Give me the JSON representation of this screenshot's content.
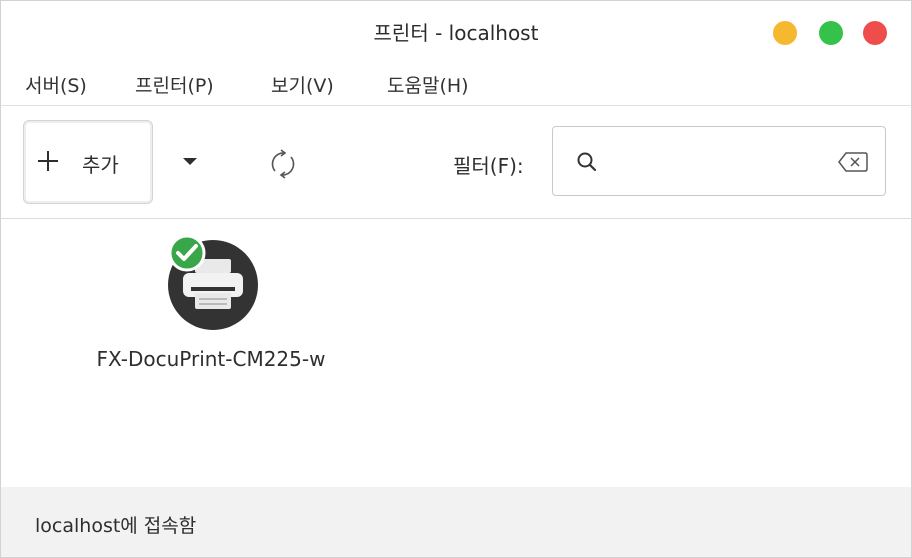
{
  "window": {
    "title": "프린터 - localhost"
  },
  "menubar": {
    "items": [
      {
        "label": "서버(S)"
      },
      {
        "label": "프린터(P)"
      },
      {
        "label": "보기(V)"
      },
      {
        "label": "도움말(H)"
      }
    ]
  },
  "toolbar": {
    "add_label": "추가",
    "filter_label": "필터(F):",
    "search_value": "",
    "search_placeholder": ""
  },
  "printers": [
    {
      "name": "FX-DocuPrint-CM225-w",
      "status": "default",
      "icon": "printer-icon"
    }
  ],
  "statusbar": {
    "text": "localhost에 접속함"
  },
  "colors": {
    "minimize": "#f5b82e",
    "maximize": "#35c24a",
    "close": "#ef4c4c",
    "default_badge": "#3aa64a",
    "printer_icon_bg": "#333333"
  }
}
